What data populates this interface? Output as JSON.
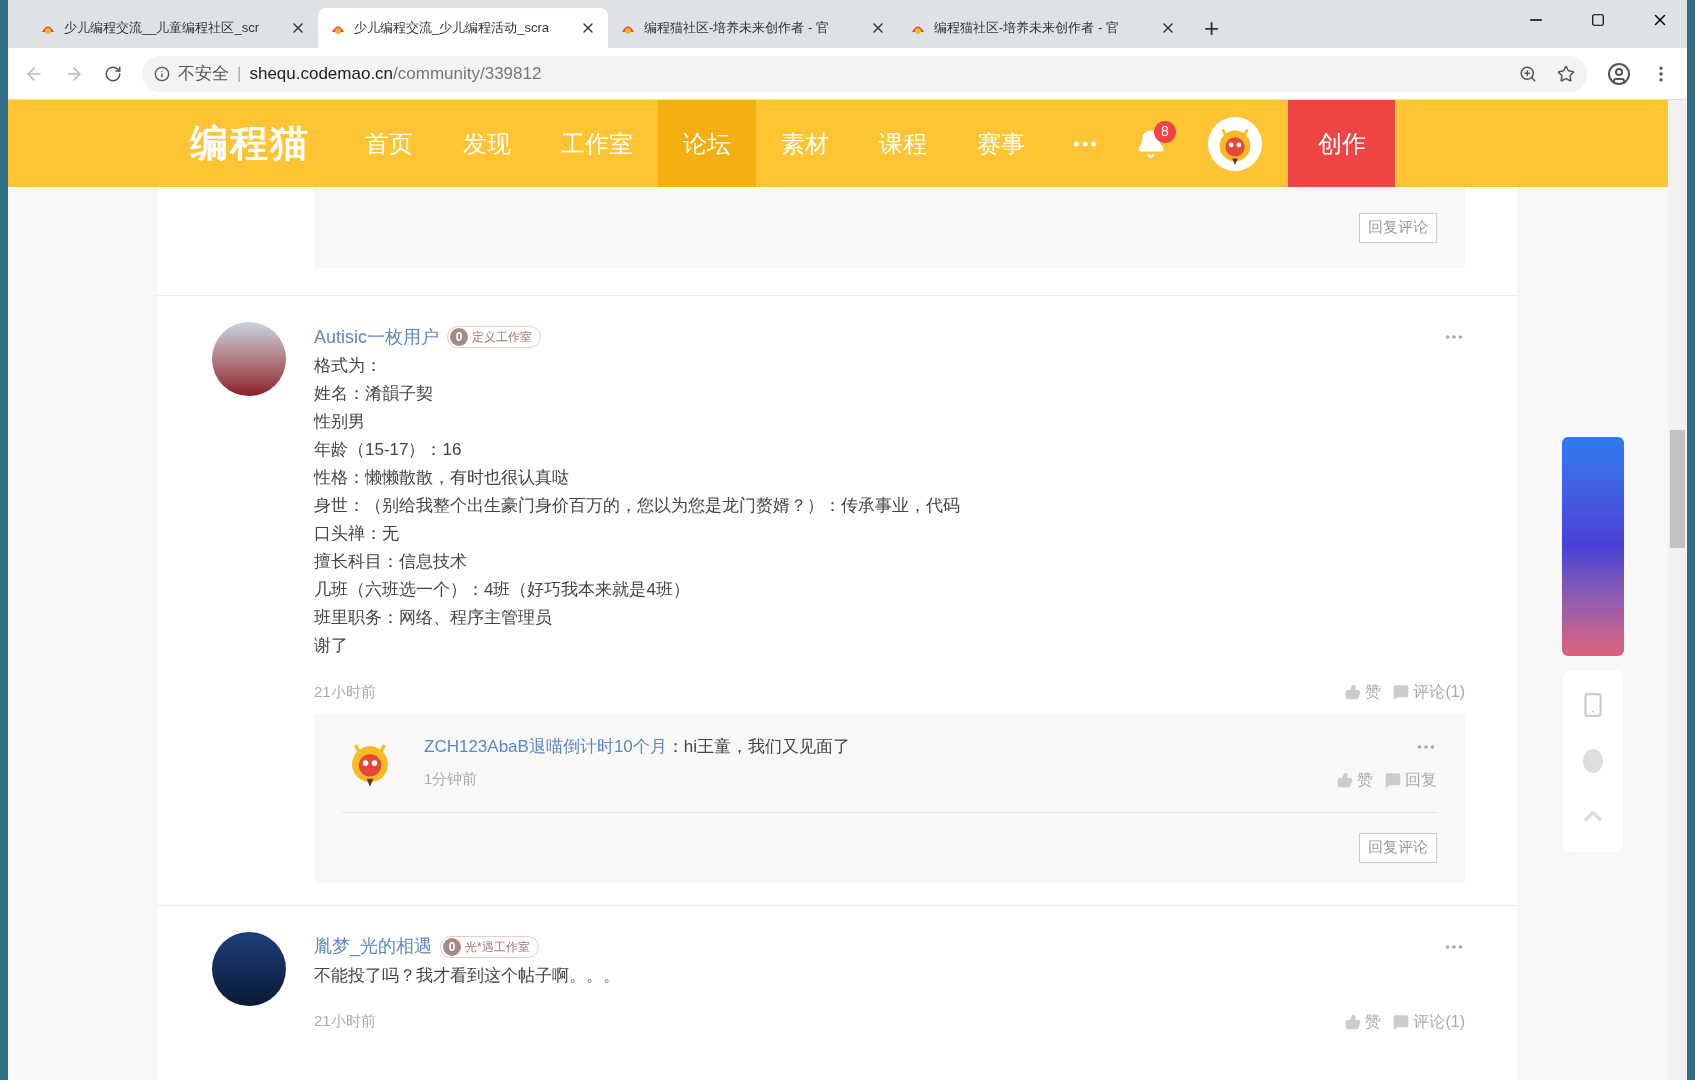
{
  "browser": {
    "tabs": [
      {
        "title": "少儿编程交流__儿童编程社区_scr",
        "selected": false
      },
      {
        "title": "少儿编程交流_少儿编程活动_scra",
        "selected": true
      },
      {
        "title": "编程猫社区-培养未来创作者 - 官",
        "selected": false
      },
      {
        "title": "编程猫社区-培养未来创作者 - 官",
        "selected": false
      }
    ],
    "new_tab": "+",
    "security": "不安全",
    "separator": "|",
    "url_host": "shequ.codemao.cn",
    "url_path": "/community/339812"
  },
  "site_nav": {
    "logo": "编程猫",
    "items": [
      {
        "label": "首页",
        "selected": false
      },
      {
        "label": "发现",
        "selected": false
      },
      {
        "label": "工作室",
        "selected": false
      },
      {
        "label": "论坛",
        "selected": true
      },
      {
        "label": "素材",
        "selected": false
      },
      {
        "label": "课程",
        "selected": false
      },
      {
        "label": "赛事",
        "selected": false
      }
    ],
    "notification_count": "8",
    "create": "创作"
  },
  "previous_reply_box": {
    "button": "回复评论"
  },
  "comments": [
    {
      "author": "Autisic一枚用户",
      "studio_level": "0",
      "studio": "定义工作室",
      "body": [
        "格式为：",
        "姓名：淆韻子契",
        "性别男",
        "年龄（15-17）：16",
        "性格：懒懒散散，有时也很认真哒",
        "身世：（别给我整个出生豪门身价百万的，您以为您是龙门赘婿？）：传承事业，代码",
        "口头禅：无",
        "擅长科目：信息技术",
        "几班（六班选一个）：4班（好巧我本来就是4班）",
        "班里职务：网络、程序主管理员",
        "谢了"
      ],
      "time": "21小时前",
      "like": "赞",
      "comment": "评论(1)",
      "replies": [
        {
          "author": "ZCH123AbaB退喵倒计时10个月",
          "text": "：hi王童，我们又见面了",
          "time": "1分钟前",
          "like": "赞",
          "reply": "回复"
        }
      ],
      "reply_button": "回复评论"
    },
    {
      "author": "胤梦_光的相遇",
      "studio_level": "0",
      "studio": "光*遇工作室",
      "body": [
        "不能投了吗？我才看到这个帖子啊。。。"
      ],
      "time": "21小时前",
      "like": "赞",
      "comment": "评论(1)"
    }
  ]
}
